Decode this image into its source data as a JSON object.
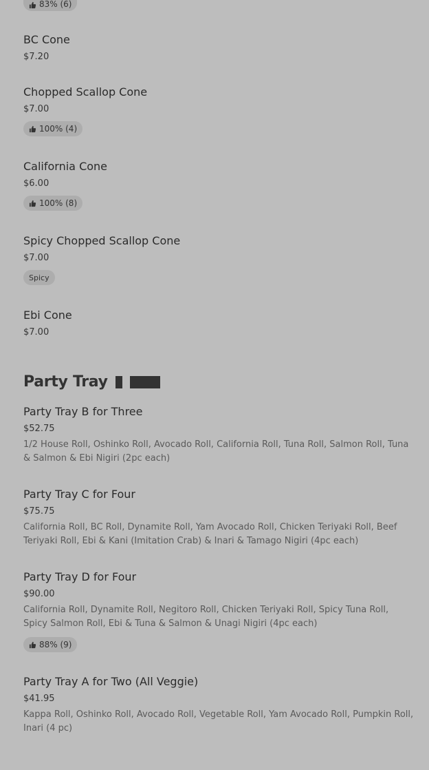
{
  "top_badge": {
    "text": "83% (6)",
    "icon": "thumbs-up-icon"
  },
  "cones": [
    {
      "name": "BC Cone",
      "price": "$7.20"
    },
    {
      "name": "Chopped Scallop Cone",
      "price": "$7.00",
      "badge": "100% (4)"
    },
    {
      "name": "California Cone",
      "price": "$6.00",
      "badge": "100% (8)"
    },
    {
      "name": "Spicy Chopped Scallop Cone",
      "price": "$7.00",
      "tag": "Spicy"
    },
    {
      "name": "Ebi Cone",
      "price": "$7.00"
    }
  ],
  "party_section": {
    "title": "Party Tray"
  },
  "party": [
    {
      "name": "Party Tray B for Three",
      "price": "$52.75",
      "desc": "1/2 House Roll, Oshinko Roll, Avocado Roll, California Roll, Tuna Roll, Salmon Roll, Tuna & Salmon & Ebi Nigiri (2pc each)"
    },
    {
      "name": "Party Tray C for Four",
      "price": "$75.75",
      "desc": "California Roll, BC Roll, Dynamite Roll, Yam Avocado Roll, Chicken Teriyaki Roll, Beef Teriyaki Roll, Ebi & Kani (Imitation Crab) & Inari & Tamago Nigiri (4pc each)"
    },
    {
      "name": "Party Tray D for Four",
      "price": "$90.00",
      "desc": "California Roll, Dynamite Roll, Negitoro Roll, Chicken Teriyaki Roll, Spicy Tuna Roll, Spicy Salmon Roll, Ebi & Tuna & Salmon & Unagi Nigiri (4pc each)",
      "badge": "88% (9)"
    },
    {
      "name": "Party Tray A for Two (All Veggie)",
      "price": "$41.95",
      "desc": "Kappa Roll, Oshinko Roll, Avocado Roll, Vegetable Roll, Yam Avocado Roll, Pumpkin Roll, Inari (4 pc)"
    }
  ]
}
